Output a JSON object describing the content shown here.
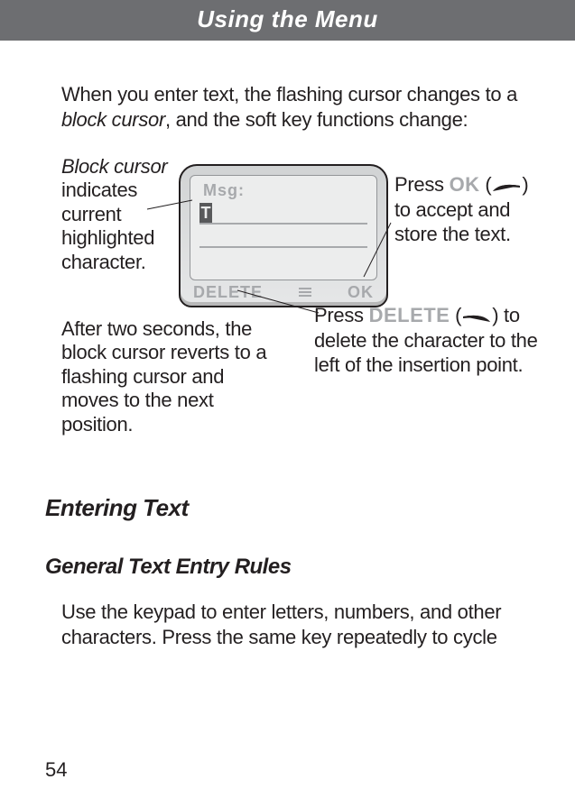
{
  "header": {
    "title": "Using the Menu"
  },
  "intro": {
    "pre": "When you enter text, the flashing cursor changes to a ",
    "em": "block cursor",
    "post": ", and the soft key functions change:"
  },
  "screen": {
    "msg_label": "Msg:",
    "cursor_char": "T",
    "softkeys": {
      "left": "DELETE",
      "right": "OK"
    }
  },
  "callouts": {
    "block_cursor_em": "Block cursor",
    "block_cursor_rest": " indicates current highlighted character.",
    "right_pre": "Press ",
    "right_code": "OK",
    "right_open": " (",
    "right_close": ") to accept and store the text.",
    "after": "After two seconds, the block cursor reverts to a flashing cursor and moves to the next position.",
    "delete_pre": "Press ",
    "delete_code": "DELETE",
    "delete_open": " (",
    "delete_close": ") to delete the character to the left of the insertion point."
  },
  "sections": {
    "h1": "Entering Text",
    "h2": "General Text Entry Rules",
    "body": "Use the keypad to enter letters, numbers, and other characters. Press the same key repeatedly to cycle"
  },
  "page_number": "54"
}
